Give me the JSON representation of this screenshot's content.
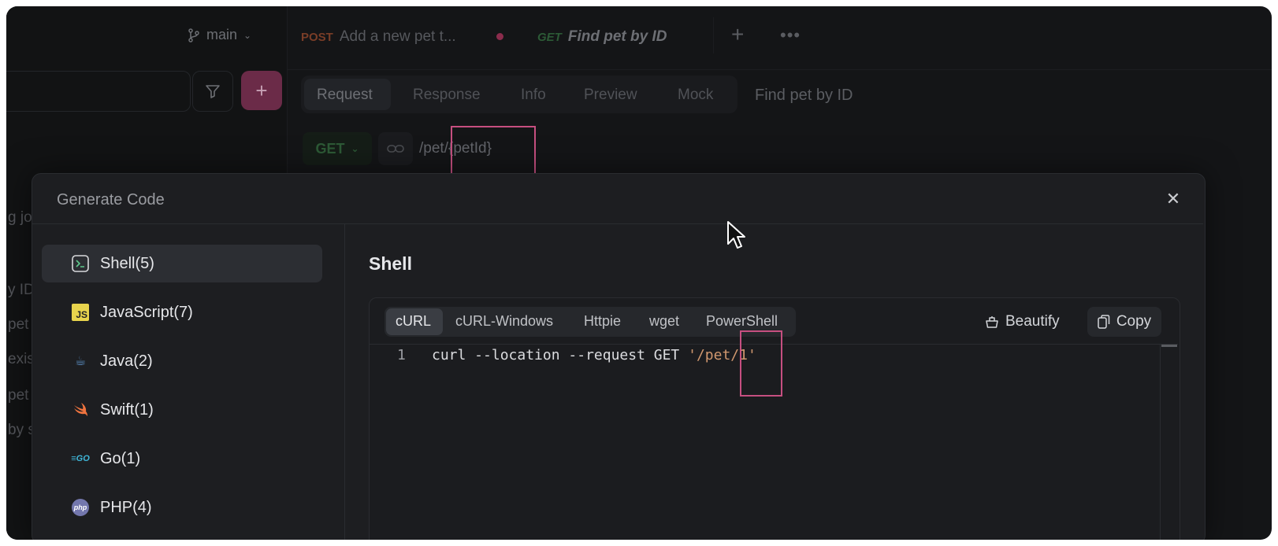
{
  "header": {
    "branch": "main",
    "tabs": [
      {
        "method": "POST",
        "label": "Add a new pet t...",
        "unsaved": true
      },
      {
        "method": "GET",
        "label": "Find pet by ID"
      }
    ]
  },
  "sidebar": {
    "fragments": [
      "g jo",
      "y ID",
      "pet",
      "exis",
      "pet",
      "by s"
    ]
  },
  "request": {
    "sub_tabs": [
      "Request",
      "Response",
      "Info",
      "Preview",
      "Mock"
    ],
    "active_sub_tab": "Request",
    "name": "Find pet by ID",
    "method": "GET",
    "url": "/pet/{petId}"
  },
  "modal": {
    "title": "Generate Code",
    "languages": [
      {
        "label": "Shell(5)",
        "icon": "terminal-icon",
        "active": true
      },
      {
        "label": "JavaScript(7)",
        "icon": "javascript-icon"
      },
      {
        "label": "Java(2)",
        "icon": "java-icon"
      },
      {
        "label": "Swift(1)",
        "icon": "swift-icon"
      },
      {
        "label": "Go(1)",
        "icon": "go-icon"
      },
      {
        "label": "PHP(4)",
        "icon": "php-icon"
      }
    ],
    "section_title": "Shell",
    "code_tabs": [
      "cURL",
      "cURL-Windows",
      "Httpie",
      "wget",
      "PowerShell"
    ],
    "active_code_tab": "cURL",
    "beautify_label": "Beautify",
    "copy_label": "Copy",
    "code": {
      "line_number": "1",
      "command": "curl --location --request GET ",
      "url_literal": "'/pet/1'"
    }
  },
  "colors": {
    "accent": "#6b2b48",
    "highlight_box": "#c64f80",
    "post": "#c0552a",
    "get": "#3f9a55",
    "string": "#d1986f"
  }
}
